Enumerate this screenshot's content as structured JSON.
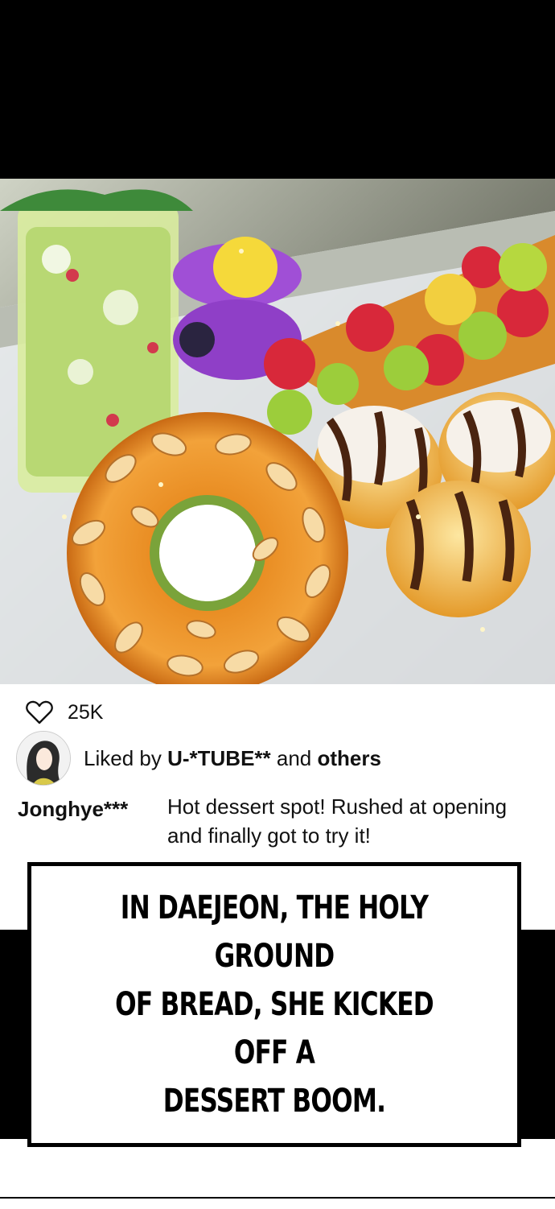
{
  "post": {
    "like_count": "25K",
    "liked_prefix": "Liked by ",
    "liked_user": "U-*TUBE**",
    "liked_middle": " and ",
    "liked_suffix": "others",
    "comment_user": "Jonghye***",
    "comment_text": "Hot dessert spot! Rushed at opening and finally got to try it!"
  },
  "caption": {
    "line1": "IN DAEJEON, THE HOLY GROUND",
    "line2": "OF BREAD, SHE KICKED OFF A",
    "line3": "DESSERT BOOM."
  },
  "icons": {
    "like": "heart-outline-icon"
  }
}
